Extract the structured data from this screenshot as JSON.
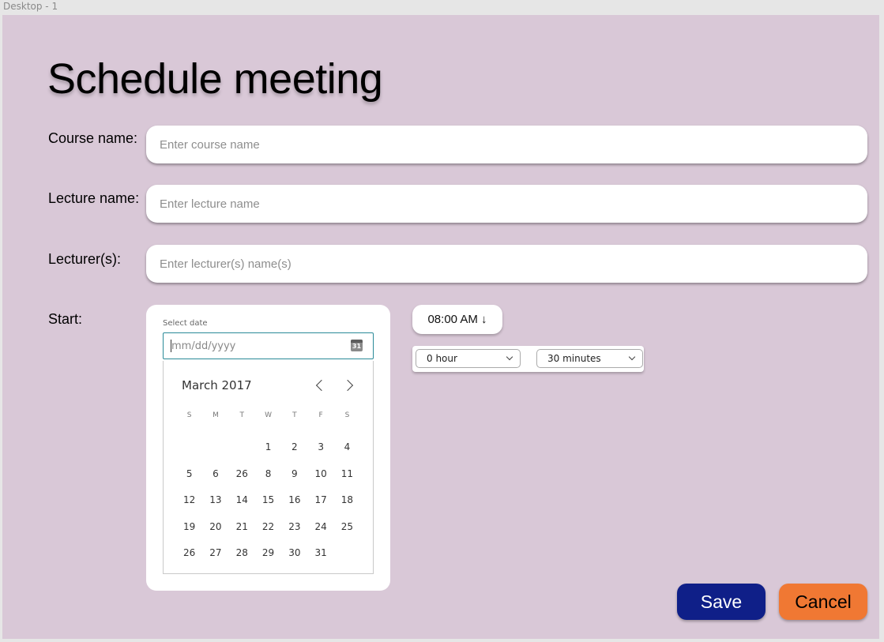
{
  "frame_label": "Desktop - 1",
  "title": "Schedule meeting",
  "fields": {
    "course": {
      "label": "Course name:",
      "placeholder": "Enter course name"
    },
    "lecture": {
      "label": "Lecture name:",
      "placeholder": "Enter lecture name"
    },
    "lecturers": {
      "label": "Lecturer(s):",
      "placeholder": "Enter lecturer(s) name(s)"
    }
  },
  "start": {
    "label": "Start:",
    "select_date_label": "Select date",
    "date_placeholder": "mm/dd/yyyy",
    "calendar_icon_text": "31",
    "month_label": "March 2017",
    "weekdays": [
      "S",
      "M",
      "T",
      "W",
      "T",
      "F",
      "S"
    ],
    "weeks": [
      [
        "",
        "",
        "",
        "1",
        "2",
        "3",
        "4"
      ],
      [
        "5",
        "6",
        "26",
        "8",
        "9",
        "10",
        "11"
      ],
      [
        "12",
        "13",
        "14",
        "15",
        "16",
        "17",
        "18"
      ],
      [
        "19",
        "20",
        "21",
        "22",
        "23",
        "24",
        "25"
      ],
      [
        "26",
        "27",
        "28",
        "29",
        "30",
        "31",
        ""
      ]
    ]
  },
  "time": {
    "value": "08:00 AM ↓"
  },
  "duration": {
    "hours": "0 hour",
    "minutes": "30 minutes"
  },
  "buttons": {
    "save": "Save",
    "cancel": "Cancel"
  },
  "colors": {
    "canvas_bg": "#d9c8d7",
    "save_bg": "#0f1f88",
    "cancel_bg": "#f07833",
    "date_focus_border": "#2a8a98"
  }
}
